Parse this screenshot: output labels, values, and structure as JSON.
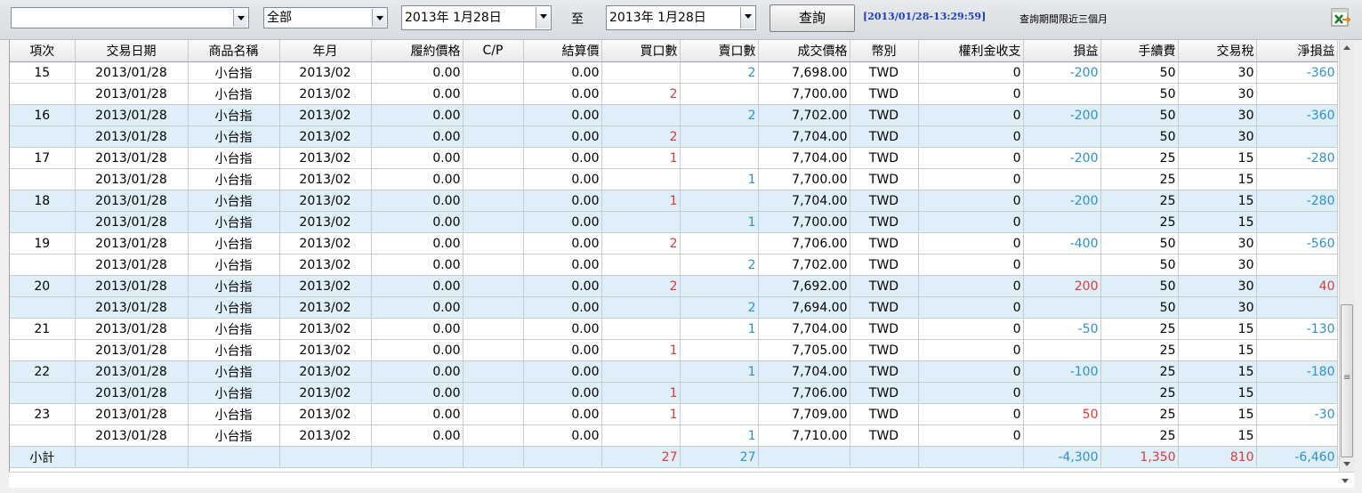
{
  "toolbar": {
    "account_value": "",
    "product_value": "全部",
    "date_from": "2013年  1月28日",
    "to_label": "至",
    "date_to": "2013年  1月28日",
    "query_button": "查詢",
    "timestamp": "[2013/01/28-13:29:59]",
    "query_note": "查詢期間限近三個月",
    "export_icon": "excel-export-icon"
  },
  "columns": [
    "項次",
    "交易日期",
    "商品名稱",
    "年月",
    "履約價格",
    "C/P",
    "結算價",
    "買口數",
    "賣口數",
    "成交價格",
    "幣別",
    "權利金收支",
    "損益",
    "手續費",
    "交易稅",
    "淨損益"
  ],
  "rows": [
    {
      "no": "15",
      "date": "2013/01/28",
      "product": "小台指",
      "ym": "2013/02",
      "strike": "0.00",
      "cp": "",
      "settle": "0.00",
      "buy": "",
      "sell": "2",
      "price": "7,698.00",
      "cur": "TWD",
      "premium": "0",
      "pnl": "-200",
      "fee": "50",
      "tax": "30",
      "net": "-360"
    },
    {
      "no": "",
      "date": "2013/01/28",
      "product": "小台指",
      "ym": "2013/02",
      "strike": "0.00",
      "cp": "",
      "settle": "0.00",
      "buy": "2",
      "sell": "",
      "price": "7,700.00",
      "cur": "TWD",
      "premium": "0",
      "pnl": "",
      "fee": "50",
      "tax": "30",
      "net": ""
    },
    {
      "no": "16",
      "date": "2013/01/28",
      "product": "小台指",
      "ym": "2013/02",
      "strike": "0.00",
      "cp": "",
      "settle": "0.00",
      "buy": "",
      "sell": "2",
      "price": "7,702.00",
      "cur": "TWD",
      "premium": "0",
      "pnl": "-200",
      "fee": "50",
      "tax": "30",
      "net": "-360"
    },
    {
      "no": "",
      "date": "2013/01/28",
      "product": "小台指",
      "ym": "2013/02",
      "strike": "0.00",
      "cp": "",
      "settle": "0.00",
      "buy": "2",
      "sell": "",
      "price": "7,704.00",
      "cur": "TWD",
      "premium": "0",
      "pnl": "",
      "fee": "50",
      "tax": "30",
      "net": ""
    },
    {
      "no": "17",
      "date": "2013/01/28",
      "product": "小台指",
      "ym": "2013/02",
      "strike": "0.00",
      "cp": "",
      "settle": "0.00",
      "buy": "1",
      "sell": "",
      "price": "7,704.00",
      "cur": "TWD",
      "premium": "0",
      "pnl": "-200",
      "fee": "25",
      "tax": "15",
      "net": "-280"
    },
    {
      "no": "",
      "date": "2013/01/28",
      "product": "小台指",
      "ym": "2013/02",
      "strike": "0.00",
      "cp": "",
      "settle": "0.00",
      "buy": "",
      "sell": "1",
      "price": "7,700.00",
      "cur": "TWD",
      "premium": "0",
      "pnl": "",
      "fee": "25",
      "tax": "15",
      "net": ""
    },
    {
      "no": "18",
      "date": "2013/01/28",
      "product": "小台指",
      "ym": "2013/02",
      "strike": "0.00",
      "cp": "",
      "settle": "0.00",
      "buy": "1",
      "sell": "",
      "price": "7,704.00",
      "cur": "TWD",
      "premium": "0",
      "pnl": "-200",
      "fee": "25",
      "tax": "15",
      "net": "-280"
    },
    {
      "no": "",
      "date": "2013/01/28",
      "product": "小台指",
      "ym": "2013/02",
      "strike": "0.00",
      "cp": "",
      "settle": "0.00",
      "buy": "",
      "sell": "1",
      "price": "7,700.00",
      "cur": "TWD",
      "premium": "0",
      "pnl": "",
      "fee": "25",
      "tax": "15",
      "net": ""
    },
    {
      "no": "19",
      "date": "2013/01/28",
      "product": "小台指",
      "ym": "2013/02",
      "strike": "0.00",
      "cp": "",
      "settle": "0.00",
      "buy": "2",
      "sell": "",
      "price": "7,706.00",
      "cur": "TWD",
      "premium": "0",
      "pnl": "-400",
      "fee": "50",
      "tax": "30",
      "net": "-560"
    },
    {
      "no": "",
      "date": "2013/01/28",
      "product": "小台指",
      "ym": "2013/02",
      "strike": "0.00",
      "cp": "",
      "settle": "0.00",
      "buy": "",
      "sell": "2",
      "price": "7,702.00",
      "cur": "TWD",
      "premium": "0",
      "pnl": "",
      "fee": "50",
      "tax": "30",
      "net": ""
    },
    {
      "no": "20",
      "date": "2013/01/28",
      "product": "小台指",
      "ym": "2013/02",
      "strike": "0.00",
      "cp": "",
      "settle": "0.00",
      "buy": "2",
      "sell": "",
      "price": "7,692.00",
      "cur": "TWD",
      "premium": "0",
      "pnl": "200",
      "fee": "50",
      "tax": "30",
      "net": "40"
    },
    {
      "no": "",
      "date": "2013/01/28",
      "product": "小台指",
      "ym": "2013/02",
      "strike": "0.00",
      "cp": "",
      "settle": "0.00",
      "buy": "",
      "sell": "2",
      "price": "7,694.00",
      "cur": "TWD",
      "premium": "0",
      "pnl": "",
      "fee": "50",
      "tax": "30",
      "net": ""
    },
    {
      "no": "21",
      "date": "2013/01/28",
      "product": "小台指",
      "ym": "2013/02",
      "strike": "0.00",
      "cp": "",
      "settle": "0.00",
      "buy": "",
      "sell": "1",
      "price": "7,704.00",
      "cur": "TWD",
      "premium": "0",
      "pnl": "-50",
      "fee": "25",
      "tax": "15",
      "net": "-130"
    },
    {
      "no": "",
      "date": "2013/01/28",
      "product": "小台指",
      "ym": "2013/02",
      "strike": "0.00",
      "cp": "",
      "settle": "0.00",
      "buy": "1",
      "sell": "",
      "price": "7,705.00",
      "cur": "TWD",
      "premium": "0",
      "pnl": "",
      "fee": "25",
      "tax": "15",
      "net": ""
    },
    {
      "no": "22",
      "date": "2013/01/28",
      "product": "小台指",
      "ym": "2013/02",
      "strike": "0.00",
      "cp": "",
      "settle": "0.00",
      "buy": "",
      "sell": "1",
      "price": "7,704.00",
      "cur": "TWD",
      "premium": "0",
      "pnl": "-100",
      "fee": "25",
      "tax": "15",
      "net": "-180"
    },
    {
      "no": "",
      "date": "2013/01/28",
      "product": "小台指",
      "ym": "2013/02",
      "strike": "0.00",
      "cp": "",
      "settle": "0.00",
      "buy": "1",
      "sell": "",
      "price": "7,706.00",
      "cur": "TWD",
      "premium": "0",
      "pnl": "",
      "fee": "25",
      "tax": "15",
      "net": ""
    },
    {
      "no": "23",
      "date": "2013/01/28",
      "product": "小台指",
      "ym": "2013/02",
      "strike": "0.00",
      "cp": "",
      "settle": "0.00",
      "buy": "1",
      "sell": "",
      "price": "7,709.00",
      "cur": "TWD",
      "premium": "0",
      "pnl": "50",
      "fee": "25",
      "tax": "15",
      "net": "-30"
    },
    {
      "no": "",
      "date": "2013/01/28",
      "product": "小台指",
      "ym": "2013/02",
      "strike": "0.00",
      "cp": "",
      "settle": "0.00",
      "buy": "",
      "sell": "1",
      "price": "7,710.00",
      "cur": "TWD",
      "premium": "0",
      "pnl": "",
      "fee": "25",
      "tax": "15",
      "net": ""
    }
  ],
  "subtotal": {
    "label": "小計",
    "buy": "27",
    "sell": "27",
    "pnl": "-4,300",
    "fee": "1,350",
    "tax": "810",
    "net": "-6,460"
  },
  "colors": {
    "positive": "#d83b3b",
    "negative": "#2f8fd0",
    "alt_row": "#deeffa",
    "timestamp": "#1a3fbf"
  }
}
